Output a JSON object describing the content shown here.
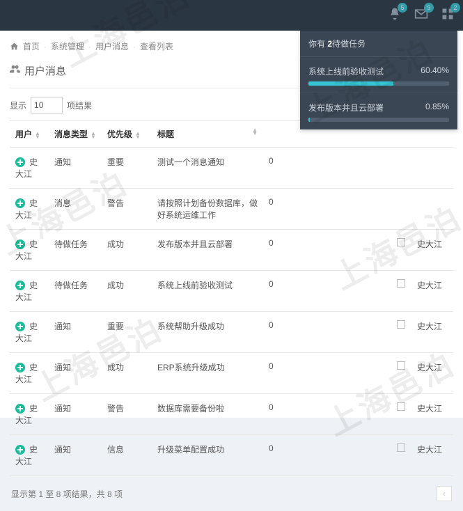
{
  "topbar": {
    "badges": {
      "bell": "5",
      "mail": "9",
      "grid": "2"
    }
  },
  "breadcrumb": {
    "home": "首页",
    "items": [
      "系统管理",
      "用户消息",
      "查看列表"
    ]
  },
  "panel": {
    "title": "用户消息"
  },
  "length": {
    "label_show": "显示",
    "value": "10",
    "label_entries": "项结果"
  },
  "columns": {
    "user": "用户",
    "type": "消息类型",
    "priority": "优先级",
    "title": "标题"
  },
  "rows": [
    {
      "user": "史大江",
      "type": "通知",
      "priority": "重要",
      "title": "测试一个消息通知",
      "count": "0",
      "from": ""
    },
    {
      "user": "史大江",
      "type": "消息",
      "priority": "警告",
      "title": "请按照计划备份数据库，做好系统运维工作",
      "count": "0",
      "from": ""
    },
    {
      "user": "史大江",
      "type": "待做任务",
      "priority": "成功",
      "title": "发布版本并且云部署",
      "count": "0",
      "from": "史大江"
    },
    {
      "user": "史大江",
      "type": "待做任务",
      "priority": "成功",
      "title": "系统上线前验收测试",
      "count": "0",
      "from": "史大江"
    },
    {
      "user": "史大江",
      "type": "通知",
      "priority": "重要",
      "title": "系统帮助升级成功",
      "count": "0",
      "from": "史大江"
    },
    {
      "user": "史大江",
      "type": "通知",
      "priority": "成功",
      "title": "ERP系统升级成功",
      "count": "0",
      "from": "史大江"
    },
    {
      "user": "史大江",
      "type": "通知",
      "priority": "警告",
      "title": "数据库需要备份啦",
      "count": "0",
      "from": "史大江"
    },
    {
      "user": "史大江",
      "type": "通知",
      "priority": "信息",
      "title": "升级菜单配置成功",
      "count": "0",
      "from": "史大江"
    }
  ],
  "footer": {
    "info": "显示第 1 至 8 项结果，共 8 项"
  },
  "notif": {
    "head_prefix": "你有 ",
    "head_bold": "2",
    "head_suffix": "待做任务",
    "tasks": [
      {
        "name": "系统上线前验收测试",
        "pct_label": "60.40%",
        "pct": 60.4
      },
      {
        "name": "发布版本并且云部署",
        "pct_label": "0.85%",
        "pct": 0.85
      }
    ]
  },
  "watermark": "上海邑泊"
}
